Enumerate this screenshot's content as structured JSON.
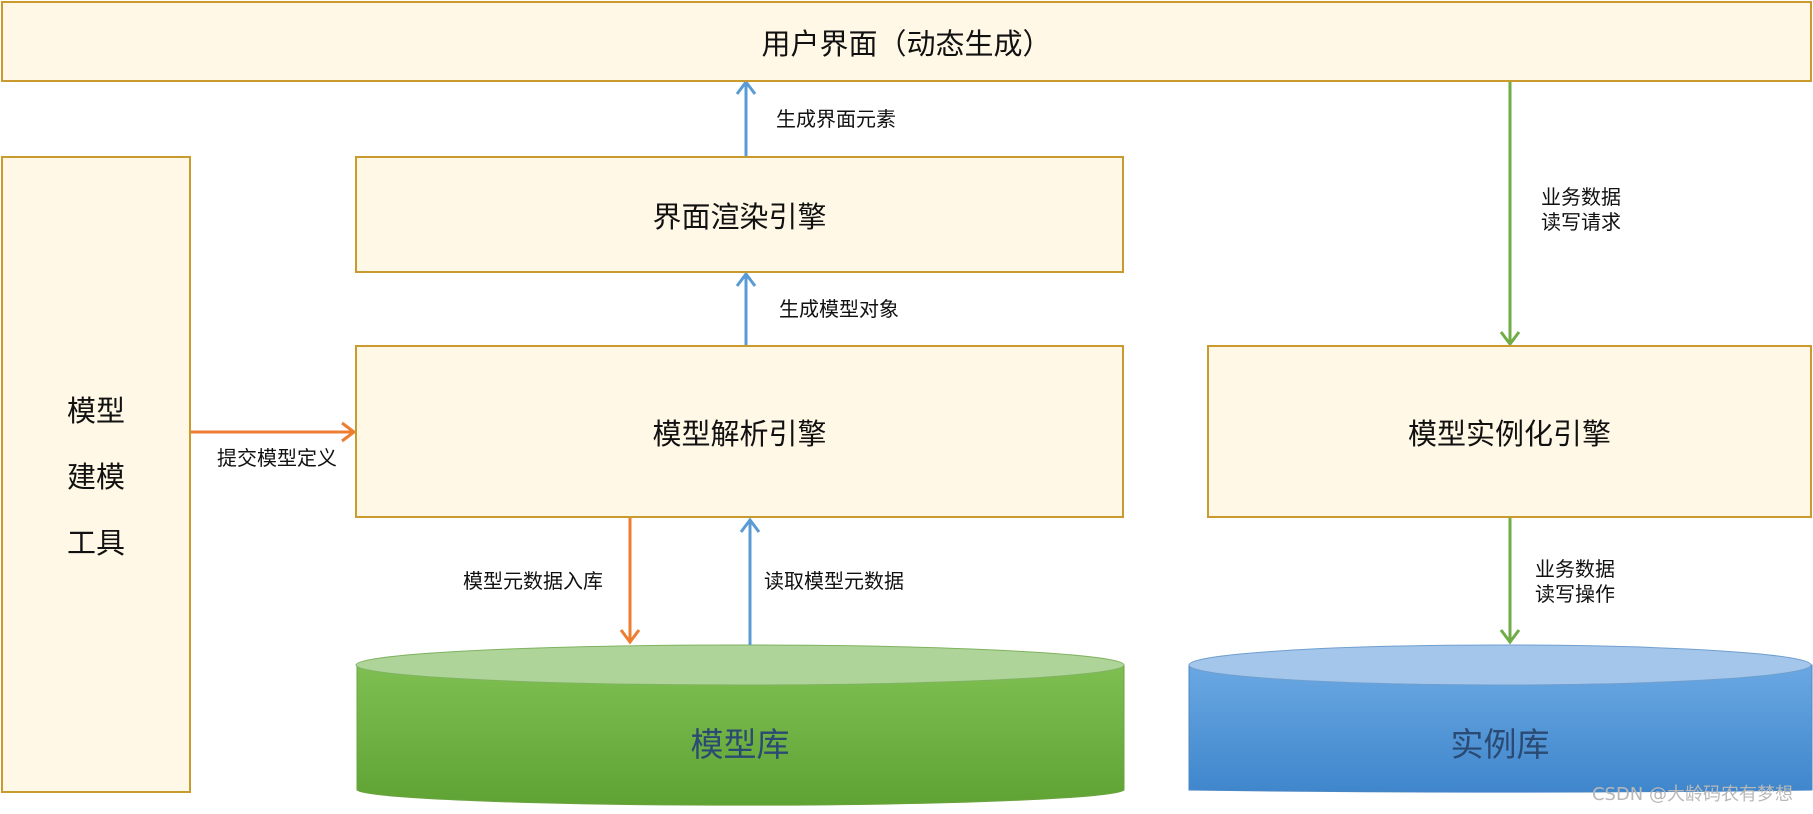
{
  "boxes": {
    "ui": "用户界面（动态生成）",
    "render_engine": "界面渲染引擎",
    "parse_engine": "模型解析引擎",
    "instance_engine": "模型实例化引擎",
    "modeling_tool": [
      "模型",
      "建模",
      "工具"
    ]
  },
  "databases": {
    "model_db": "模型库",
    "instance_db": "实例库"
  },
  "edges": {
    "gen_ui_elements": "生成界面元素",
    "gen_model_objects": "生成模型对象",
    "submit_model_def": "提交模型定义",
    "metadata_store": "模型元数据入库",
    "read_metadata": "读取模型元数据",
    "biz_rw_request": [
      "业务数据",
      "读写请求"
    ],
    "biz_rw_operation": [
      "业务数据",
      "读写操作"
    ]
  },
  "colors": {
    "box_fill": "#fff8e6",
    "box_border": "#c99a2e",
    "arrow_blue": "#5b9bd5",
    "arrow_orange": "#ed7d31",
    "arrow_green": "#70ad47",
    "db_green": "#6aad3f",
    "db_blue": "#4f93d6"
  },
  "watermark": "CSDN @大龄码农有梦想"
}
